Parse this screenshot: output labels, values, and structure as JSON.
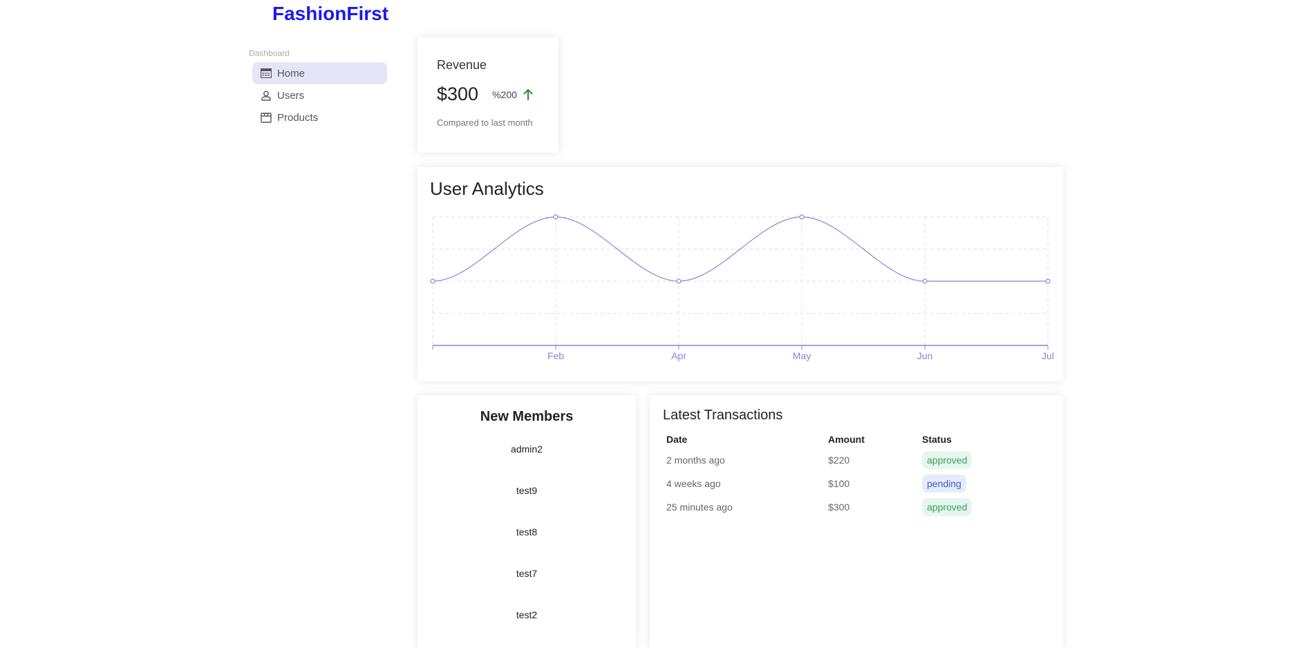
{
  "brand": "FashionFirst",
  "sidebar": {
    "section": "Dashboard",
    "items": [
      {
        "label": "Home",
        "icon": "dashboard-icon"
      },
      {
        "label": "Users",
        "icon": "user-icon"
      },
      {
        "label": "Products",
        "icon": "storefront-icon"
      }
    ]
  },
  "revenue": {
    "title": "Revenue",
    "value": "$300",
    "rate": "%200",
    "trend": "up",
    "subtitle": "Compared to last month",
    "trend_color": "#2e8b2e"
  },
  "analytics": {
    "title": "User Analytics",
    "accent": "#8884d8"
  },
  "chart_data": {
    "type": "line",
    "x": [
      "",
      "Feb",
      "Apr",
      "May",
      "Jun",
      "Jul"
    ],
    "series": [
      {
        "values": [
          2,
          4,
          2,
          4,
          2,
          2
        ]
      }
    ],
    "ylim": [
      0,
      4
    ],
    "grid": true,
    "curve": "monotone"
  },
  "members": {
    "title": "New Members",
    "list": [
      "admin2",
      "test9",
      "test8",
      "test7",
      "test2"
    ]
  },
  "transactions": {
    "title": "Latest Transactions",
    "headers": {
      "date": "Date",
      "amount": "Amount",
      "status": "Status"
    },
    "rows": [
      {
        "date": "2 months ago",
        "amount": "$220",
        "status": "approved"
      },
      {
        "date": "4 weeks ago",
        "amount": "$100",
        "status": "pending"
      },
      {
        "date": "25 minutes ago",
        "amount": "$300",
        "status": "approved"
      }
    ]
  }
}
